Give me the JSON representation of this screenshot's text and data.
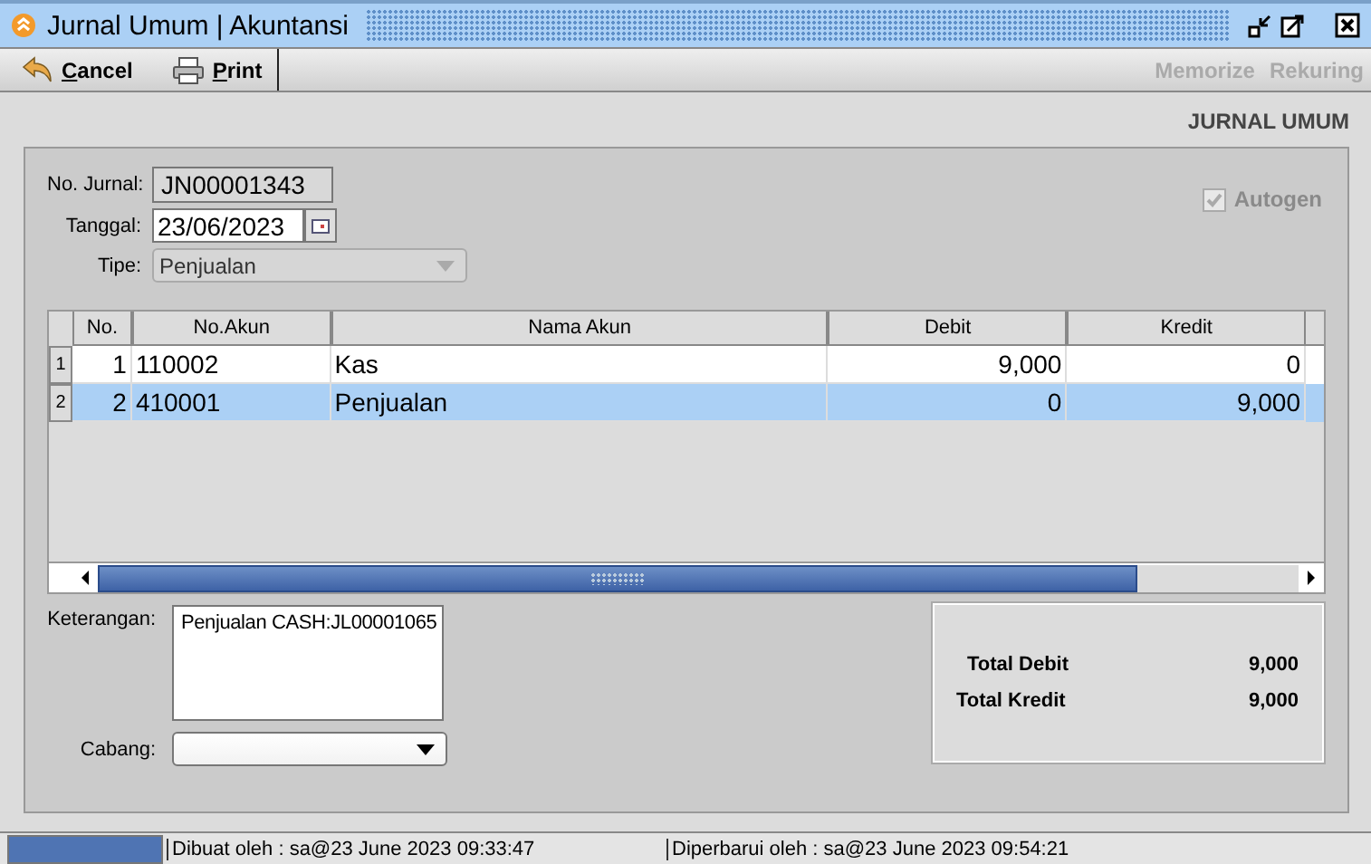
{
  "window": {
    "title": "Jurnal Umum | Akuntansi"
  },
  "toolbar": {
    "left": [
      {
        "label": "Cancel",
        "kind": "cancel"
      },
      {
        "label": "Print",
        "kind": "print"
      }
    ],
    "right": [
      {
        "label": "Memorize",
        "disabled": true
      },
      {
        "label": "Rekuring",
        "disabled": true
      }
    ]
  },
  "form_title": "JURNAL UMUM",
  "fields": {
    "no_jurnal": {
      "label": "No. Jurnal:",
      "value": "JN00001343"
    },
    "tanggal": {
      "label": "Tanggal:",
      "value": "23/06/2023"
    },
    "tipe": {
      "label": "Tipe:",
      "value": "Penjualan",
      "disabled": true
    }
  },
  "autogen": {
    "label": "Autogen",
    "checked": true,
    "disabled": true
  },
  "table": {
    "columns": [
      "No.",
      "No.Akun",
      "Nama Akun",
      "Debit",
      "Kredit"
    ],
    "rows": [
      {
        "row_header": "1",
        "cells": [
          "1",
          "110002",
          "Kas",
          "9,000",
          "0"
        ],
        "selected": false
      },
      {
        "row_header": "2",
        "cells": [
          "2",
          "410001",
          "Penjualan",
          "0",
          "9,000"
        ],
        "selected": true
      }
    ]
  },
  "keterangan": {
    "label": "Keterangan:",
    "value": "Penjualan CASH:JL00001065"
  },
  "cabang": {
    "label": "Cabang:"
  },
  "totals": [
    {
      "label": "Total Debit",
      "value": "9,000"
    },
    {
      "label": "Total Kredit",
      "value": "9,000"
    }
  ],
  "status_bar": [
    "Dibuat oleh : sa@23 June 2023  09:33:47",
    "Diperbarui oleh : sa@23 June 2023  09:54:21"
  ]
}
